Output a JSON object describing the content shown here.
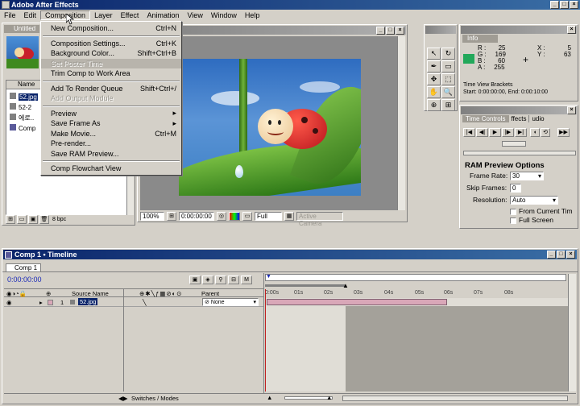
{
  "app": {
    "title": "Adobe After Effects",
    "menu": [
      "File",
      "Edit",
      "Composition",
      "Layer",
      "Effect",
      "Animation",
      "View",
      "Window",
      "Help"
    ]
  },
  "composition_menu": {
    "items": [
      {
        "label": "New Composition...",
        "shortcut": "Ctrl+N",
        "disabled": false
      },
      {
        "sep": true
      },
      {
        "label": "Composition Settings...",
        "shortcut": "Ctrl+K",
        "disabled": false
      },
      {
        "label": "Background Color...",
        "shortcut": "Shift+Ctrl+B",
        "disabled": false
      },
      {
        "label": "Set Poster Time",
        "shortcut": "",
        "disabled": true
      },
      {
        "label": "Trim Comp to Work Area",
        "shortcut": "",
        "disabled": false
      },
      {
        "sep": true
      },
      {
        "label": "Add To Render Queue",
        "shortcut": "Shift+Ctrl+/",
        "disabled": false
      },
      {
        "label": "Add Output Module",
        "shortcut": "",
        "disabled": true
      },
      {
        "sep": true
      },
      {
        "label": "Preview",
        "shortcut": "▸",
        "disabled": false
      },
      {
        "label": "Save Frame As",
        "shortcut": "▸",
        "disabled": false
      },
      {
        "label": "Make Movie...",
        "shortcut": "Ctrl+M",
        "disabled": false
      },
      {
        "label": "Pre-render...",
        "shortcut": "",
        "disabled": false
      },
      {
        "label": "Save RAM Preview...",
        "shortcut": "",
        "disabled": false
      },
      {
        "sep": true
      },
      {
        "label": "Comp Flowchart View",
        "shortcut": "",
        "disabled": false
      }
    ]
  },
  "project": {
    "tab": "Untitled",
    "column_name": "Name",
    "items": [
      "52.jpg",
      "52-2",
      "에로..",
      "Comp"
    ],
    "footer_bpc": "8 bpc"
  },
  "comp_window": {
    "zoom": "100%",
    "timecode": "0:00:00:00",
    "resolution": "Full",
    "camera": "Active Camera"
  },
  "info": {
    "tab": "Info",
    "color": "#22a85a",
    "r_label": "R :",
    "r": "25",
    "g_label": "G :",
    "g": "169",
    "b_label": "B :",
    "b": "60",
    "a_label": "A :",
    "a": "255",
    "x_label": "X :",
    "x": "5",
    "y_label": "Y :",
    "y": "63",
    "line1": "Time View Brackets",
    "line2": "Start: 0:00:00:00, End: 0:00:10:00"
  },
  "time_controls": {
    "tab1": "Time Controls",
    "tab2": "ffects",
    "tab3": "udio",
    "ram_title": "RAM Preview Options",
    "frame_rate_label": "Frame Rate:",
    "frame_rate": "30",
    "skip_frames_label": "Skip Frames:",
    "skip_frames": "0",
    "resolution_label": "Resolution:",
    "resolution": "Auto",
    "from_current": "From Current Tim",
    "full_screen": "Full Screen"
  },
  "timeline": {
    "title": "Comp 1 • Timeline",
    "tab": "Comp 1",
    "timecode": "0:00:00:00",
    "col_source": "Source Name",
    "col_parent": "Parent",
    "layer_num": "1",
    "layer_name": "52.jpg",
    "parent_value": "None",
    "ruler": [
      "0:00s",
      "01s",
      "02s",
      "03s",
      "04s",
      "05s",
      "06s",
      "07s",
      "08s"
    ],
    "footer_toggle": "Switches / Modes"
  },
  "colors": {
    "title_active": "#0a246a",
    "timeline_bar": "#d9a7b8",
    "sky": "#3f7fc6",
    "leaf": "#3f8a1f"
  }
}
